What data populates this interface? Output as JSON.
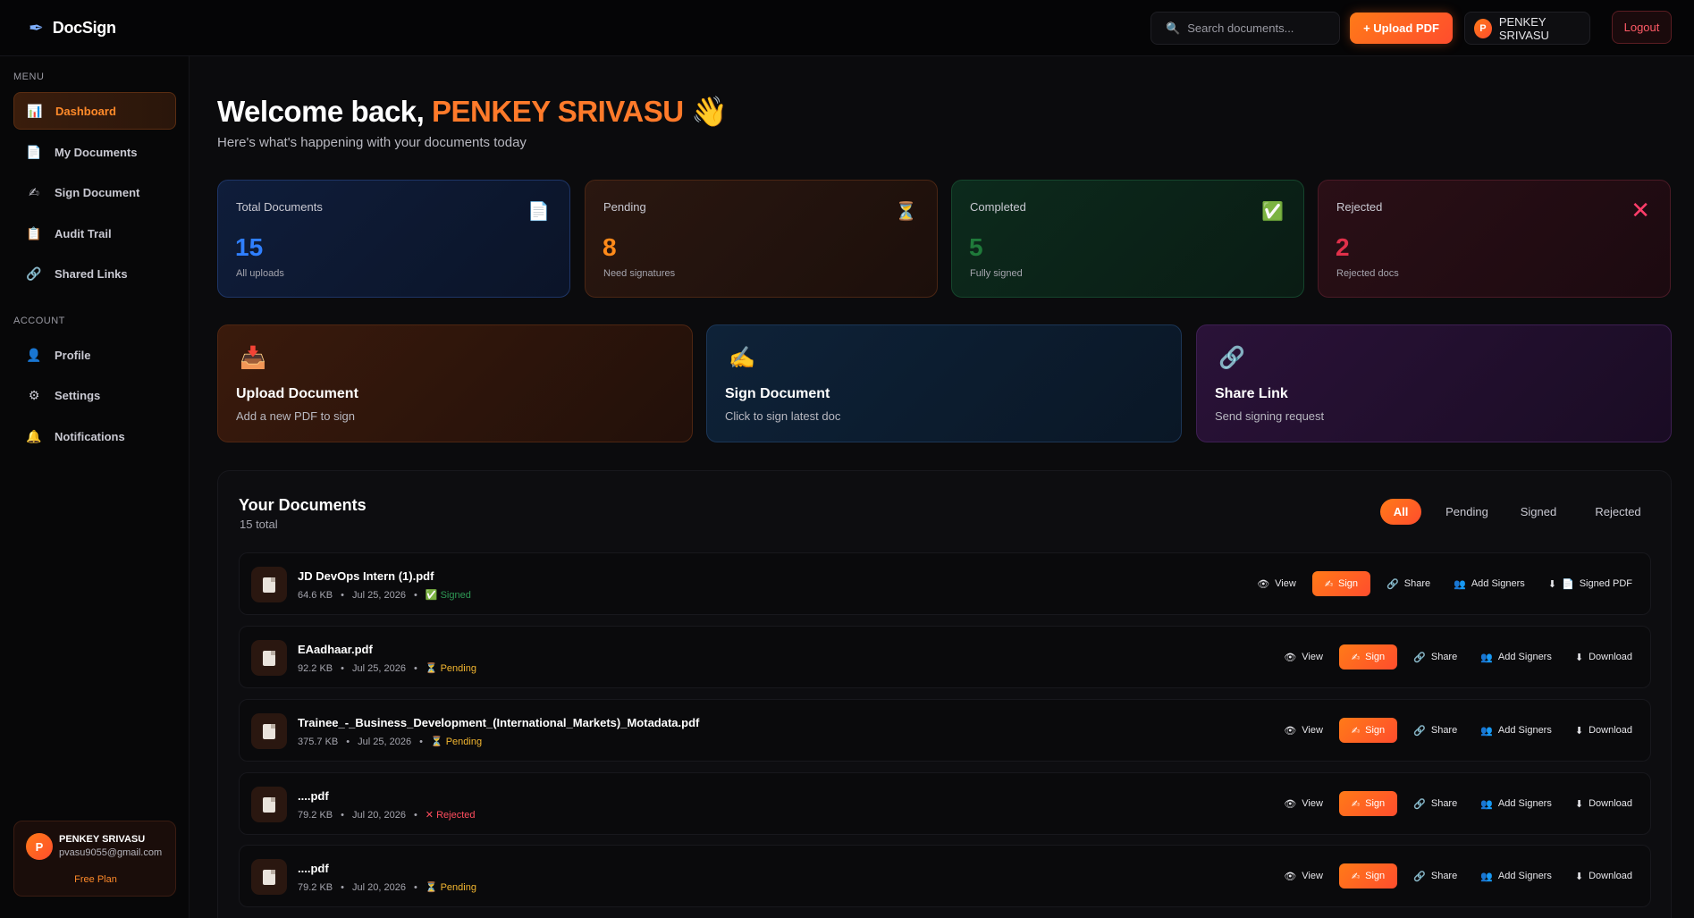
{
  "app": {
    "name": "DocSign"
  },
  "topbar": {
    "search_placeholder": "Search documents...",
    "upload_label": "+ Upload PDF",
    "user_initial": "P",
    "user_name": "PENKEY SRIVASU",
    "logout_label": "Logout"
  },
  "sidebar": {
    "menu_label": "MENU",
    "account_label": "ACCOUNT",
    "menu_items": [
      {
        "label": "Dashboard",
        "icon": "chart-icon"
      },
      {
        "label": "My Documents",
        "icon": "document-icon"
      },
      {
        "label": "Sign Document",
        "icon": "writing-hand-icon"
      },
      {
        "label": "Audit Trail",
        "icon": "clipboard-icon"
      },
      {
        "label": "Shared Links",
        "icon": "link-icon"
      }
    ],
    "account_items": [
      {
        "label": "Profile",
        "icon": "user-icon"
      },
      {
        "label": "Settings",
        "icon": "gear-icon"
      },
      {
        "label": "Notifications",
        "icon": "bell-icon"
      }
    ],
    "user_card": {
      "initial": "P",
      "name": "PENKEY SRIVASU",
      "email": "pvasu9055@gmail.com",
      "plan": "Free Plan"
    }
  },
  "welcome": {
    "prefix": "Welcome back,",
    "name": "PENKEY SRIVASU",
    "emoji": "👋",
    "subtitle": "Here's what's happening with your documents today"
  },
  "stats": [
    {
      "label": "Total Documents",
      "value": "15",
      "sub": "All uploads",
      "icon": "document-icon",
      "color": "#2f7fff"
    },
    {
      "label": "Pending",
      "value": "8",
      "sub": "Need signatures",
      "icon": "hourglass-icon",
      "color": "#ff8a1a"
    },
    {
      "label": "Completed",
      "value": "5",
      "sub": "Fully signed",
      "icon": "check-icon",
      "color": "#1f7a3a"
    },
    {
      "label": "Rejected",
      "value": "2",
      "sub": "Rejected docs",
      "icon": "cross-icon",
      "color": "#e0304a"
    }
  ],
  "quick_actions": [
    {
      "title": "Upload Document",
      "sub": "Add a new PDF to sign",
      "icon": "inbox-icon"
    },
    {
      "title": "Sign Document",
      "sub": "Click to sign latest doc",
      "icon": "writing-hand-icon"
    },
    {
      "title": "Share Link",
      "sub": "Send signing request",
      "icon": "link-icon"
    }
  ],
  "documents": {
    "title": "Your Documents",
    "count": "15 total",
    "filters": [
      "All",
      "Pending",
      "Signed",
      "Rejected"
    ],
    "active_filter": "All",
    "action_labels": {
      "view": "View",
      "sign": "Sign",
      "share": "Share",
      "add_signers": "Add Signers",
      "signed_pdf": "Signed PDF",
      "download": "Download"
    },
    "rows": [
      {
        "name": "JD DevOps Intern (1).pdf",
        "size": "64.6 KB",
        "date": "Jul 25, 2026",
        "status": "Signed"
      },
      {
        "name": "EAadhaar.pdf",
        "size": "92.2 KB",
        "date": "Jul 25, 2026",
        "status": "Pending"
      },
      {
        "name": "Trainee_-_Business_Development_(International_Markets)_Motadata.pdf",
        "size": "375.7 KB",
        "date": "Jul 25, 2026",
        "status": "Pending"
      },
      {
        "name": "....pdf",
        "size": "79.2 KB",
        "date": "Jul 20, 2026",
        "status": "Rejected"
      },
      {
        "name": "....pdf",
        "size": "79.2 KB",
        "date": "Jul 20, 2026",
        "status": "Pending"
      }
    ]
  }
}
